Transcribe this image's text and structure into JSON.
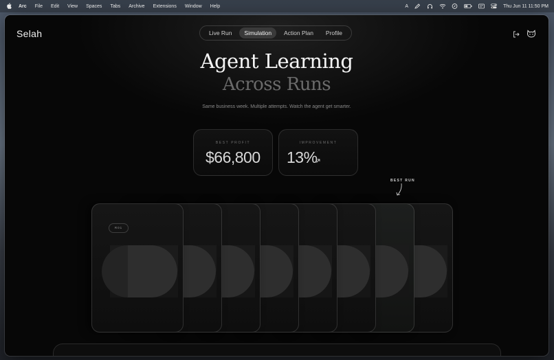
{
  "menubar": {
    "app_name": "Arc",
    "items": [
      "File",
      "Edit",
      "View",
      "Spaces",
      "Tabs",
      "Archive",
      "Extensions",
      "Window",
      "Help"
    ],
    "status_text": "A",
    "datetime": "Thu Jun 11  11:50 PM"
  },
  "app": {
    "brand": "Selah",
    "tabs": [
      "Live Run",
      "Simulation",
      "Action Plan",
      "Profile"
    ],
    "active_tab": "Simulation"
  },
  "hero": {
    "title_line1": "Agent Learning",
    "title_line2": "Across Runs",
    "subtitle": "Same business week. Multiple attempts. Watch the agent get smarter."
  },
  "stats": {
    "best_profit_label": "BEST PROFIT",
    "best_profit_value": "$66,800",
    "improvement_label": "IMPROVEMENT",
    "improvement_value": "13%"
  },
  "runs": {
    "best_run_label": "BEST RUN",
    "first_badge": "R01",
    "count": 8,
    "best_index": 7
  },
  "colors": {
    "background": "#070707",
    "card": "#121212",
    "muted_text": "#6b6b6b"
  }
}
